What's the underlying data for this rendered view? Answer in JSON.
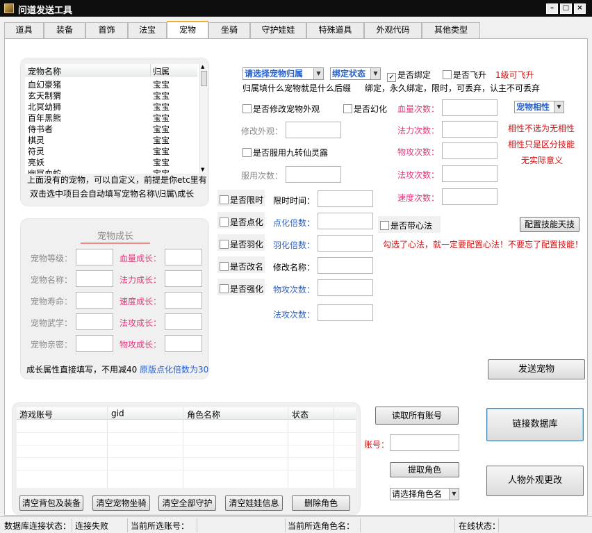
{
  "app": {
    "title": "问道发送工具"
  },
  "tabs": [
    "道具",
    "装备",
    "首饰",
    "法宝",
    "宠物",
    "坐骑",
    "守护娃娃",
    "特殊道具",
    "外观代码",
    "其他类型"
  ],
  "pet_list": {
    "headers": [
      "宠物名称",
      "归属"
    ],
    "rows": [
      [
        "血幻豪猪",
        "宝宝"
      ],
      [
        "玄天制猬",
        "宝宝"
      ],
      [
        "北冥幼狮",
        "宝宝"
      ],
      [
        "百年黑熊",
        "宝宝"
      ],
      [
        "侍书者",
        "宝宝"
      ],
      [
        "棋灵",
        "宝宝"
      ],
      [
        "符灵",
        "宝宝"
      ],
      [
        "亮妖",
        "宝宝"
      ],
      [
        "幽冥血蛇",
        "宝宝"
      ]
    ],
    "note1": "上面没有的宠物，可以自定义，前提是你etc里有",
    "note2": "双击选中项目会自动填写宠物名称\\归属\\成长"
  },
  "growth": {
    "title": "宠物成长",
    "left_labels": [
      "宠物等级：",
      "宠物名称：",
      "宠物寿命：",
      "宠物武学：",
      "宠物亲密："
    ],
    "right_labels": [
      "血量成长：",
      "法力成长：",
      "速度成长：",
      "法攻成长：",
      "物攻成长："
    ],
    "note": "成长属性直接填写，不用减40",
    "note_blue": "原版点化倍数为30"
  },
  "options": {
    "owner_select": "请选择宠物归属",
    "bind_select": "绑定状态",
    "is_bound": "是否绑定",
    "is_fly": "是否飞升",
    "fly_note": "1级可飞升",
    "owner_note": "归属填什么宠物就是什么后缀",
    "bind_note": "绑定，永久绑定，限时，可丢弃，认主不可丢弃",
    "modify_look": "是否修改宠物外观",
    "is_huanhua": "是否幻化",
    "modify_look_label": "修改外观：",
    "jiuzhuan": "是否服用九转仙灵露",
    "use_count": "服用次数：",
    "hp_count": "血量次数：",
    "mp_count": "法力次数：",
    "patk_count": "物攻次数：",
    "matk_count": "法攻次数：",
    "spd_count": "速度次数：",
    "affinity_select": "宠物相性",
    "aff_note1": "相性不选为无相性",
    "aff_note2": "相性只是区分技能",
    "aff_note3": "无实际意义",
    "is_limit": "是否限时",
    "limit_time": "限时时间：",
    "is_dianhua": "是否点化",
    "dianhua_mult": "点化倍数：",
    "is_yuhua": "是否羽化",
    "yuhua_mult": "羽化倍数：",
    "is_rename": "是否改名",
    "rename": "修改名称：",
    "is_qianghua": "是否强化",
    "patk_times": "物攻次数：",
    "matk_times": "法攻次数：",
    "xinfa": "是否带心法",
    "config_skill": "配置技能天技",
    "xinfa_note": "勾选了心法，就一定要配置心法！不要忘了配置技能！"
  },
  "send_button": "发送宠物",
  "accounts": {
    "headers": [
      "游戏账号",
      "gid",
      "角色名称",
      "状态"
    ],
    "buttons": [
      "清空背包及装备",
      "清空宠物坐骑",
      "清空全部守护",
      "清空娃娃信息",
      "删除角色"
    ]
  },
  "right": {
    "read_all": "读取所有账号",
    "account_label": "账号：",
    "fetch_role": "提取角色",
    "role_select": "请选择角色名",
    "link_db": "链接数据库",
    "look_change": "人物外观更改"
  },
  "status": {
    "db_label": "数据库连接状态：",
    "db_value": "连接失败",
    "acct_label": "当前所选账号：",
    "role_label": "当前所选角色名：",
    "online_label": "在线状态："
  }
}
